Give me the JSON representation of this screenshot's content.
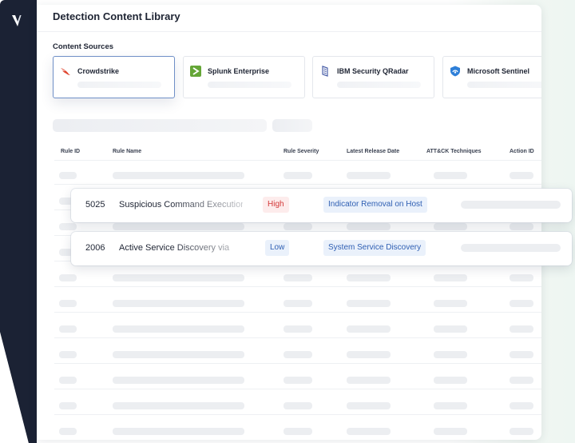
{
  "app": {
    "title": "Detection Content Library"
  },
  "sources": {
    "label": "Content Sources",
    "items": [
      {
        "name": "Crowdstrike",
        "icon": "crowdstrike-falcon-icon",
        "selected": true,
        "color": "#e0452f"
      },
      {
        "name": "Splunk Enterprise",
        "icon": "splunk-chevron-icon",
        "selected": false,
        "color": "#65a637"
      },
      {
        "name": "IBM Security QRadar",
        "icon": "qradar-icon",
        "selected": false,
        "color": "#4a5fa8"
      },
      {
        "name": "Microsoft Sentinel",
        "icon": "sentinel-shield-icon",
        "selected": false,
        "color": "#2e7fd8"
      }
    ]
  },
  "table": {
    "columns": [
      "Rule ID",
      "Rule Name",
      "Rule Severity",
      "Latest Release Date",
      "ATT&CK Techniques",
      "Action ID"
    ],
    "highlighted_rows": [
      {
        "id": "5025",
        "name": "Suspicious Command Execution",
        "severity": "High",
        "technique": "Indicator Removal on Host"
      },
      {
        "id": "2006",
        "name": "Active Service Discovery via",
        "severity": "Low",
        "technique": "System Service Discovery"
      }
    ]
  },
  "colors": {
    "sidebar": "#1b2234",
    "severity_high": "#d33a3a",
    "severity_low": "#2f5fb3",
    "selected_border": "#6f8fc7"
  }
}
